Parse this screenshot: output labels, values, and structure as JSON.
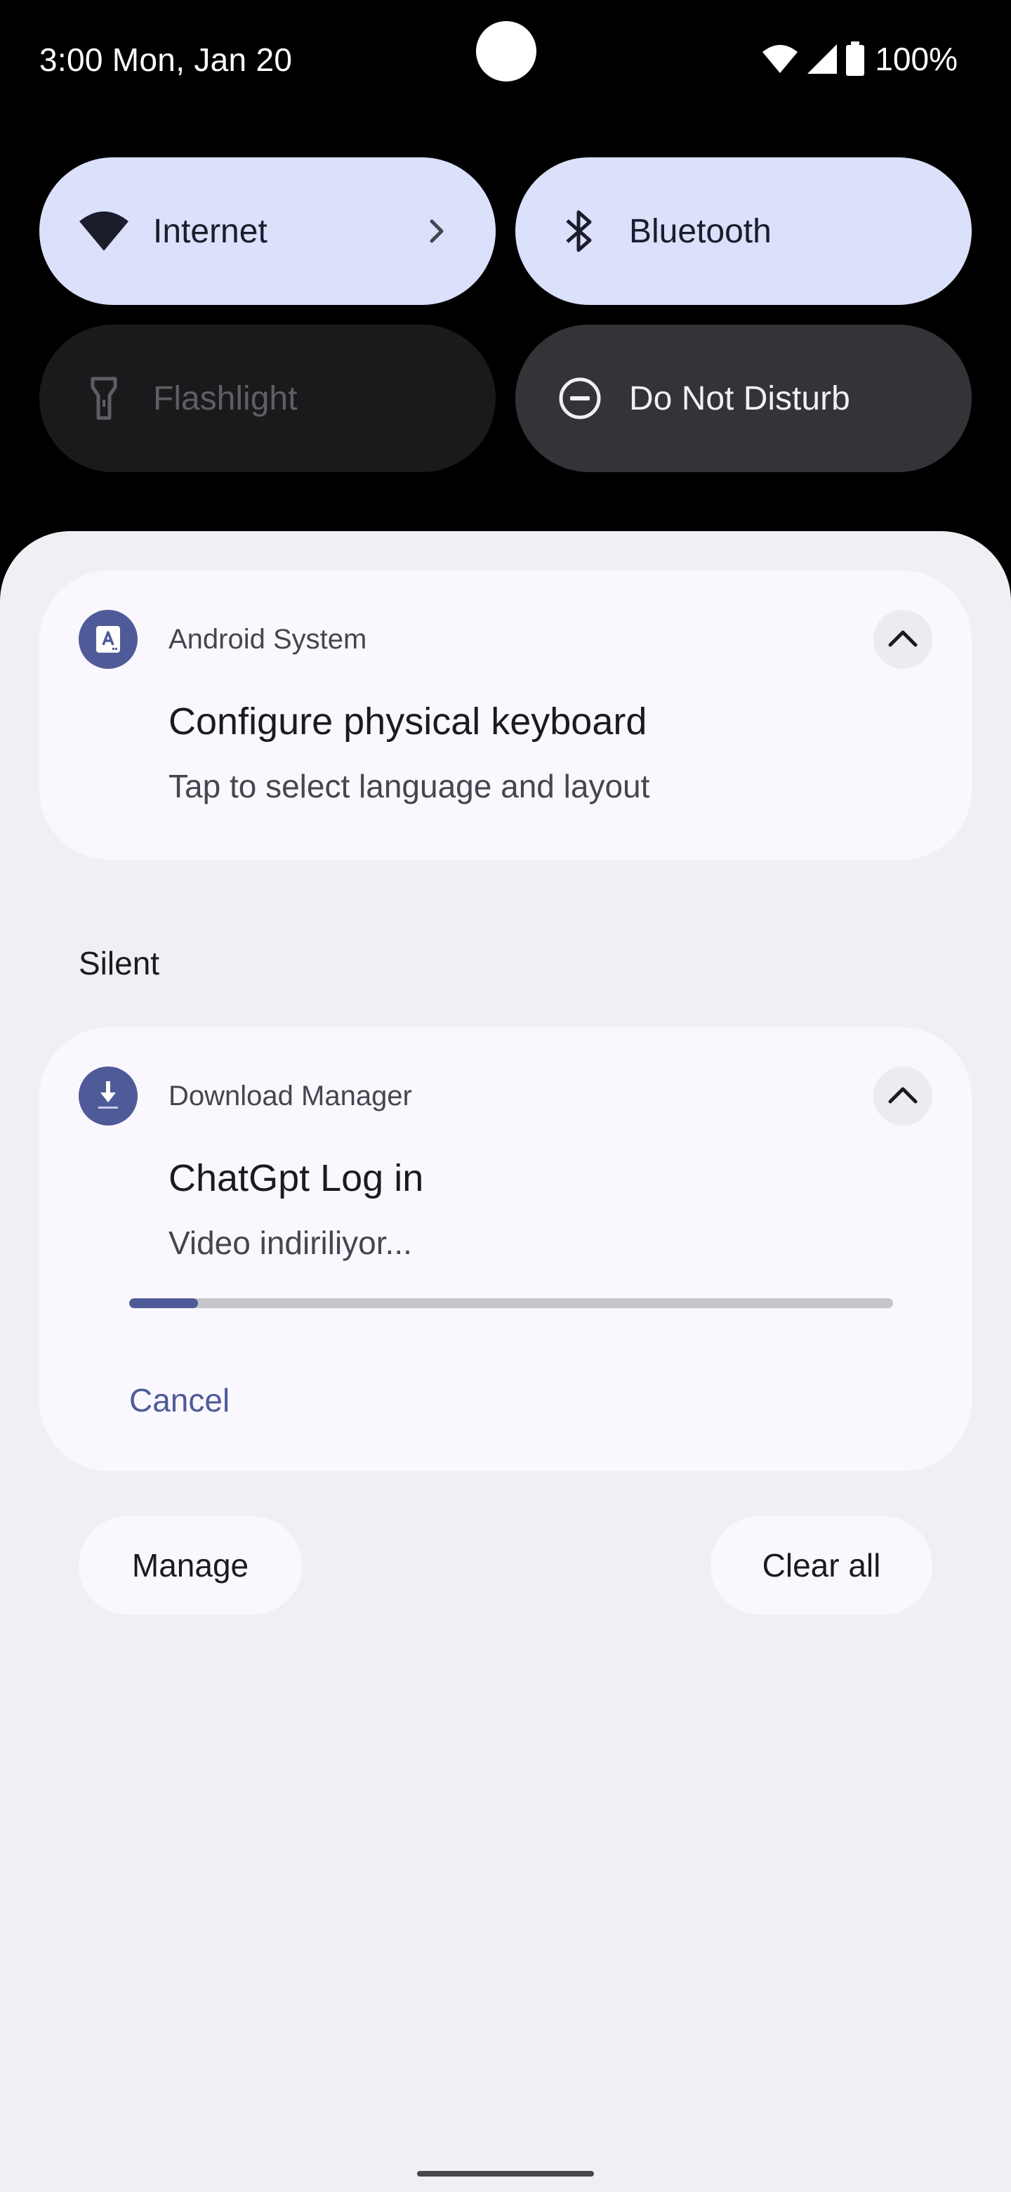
{
  "status_bar": {
    "time": "3:00 Mon, Jan 20",
    "battery": "100%",
    "icons": [
      "wifi-icon",
      "cell-signal-icon",
      "battery-icon"
    ]
  },
  "quick_settings": {
    "internet": {
      "label": "Internet",
      "state": "on",
      "icon": "wifi-icon"
    },
    "bluetooth": {
      "label": "Bluetooth",
      "state": "on",
      "icon": "bluetooth-icon"
    },
    "flashlight": {
      "label": "Flashlight",
      "state": "unavailable",
      "icon": "flashlight-icon"
    },
    "dnd": {
      "label": "Do Not Disturb",
      "state": "off",
      "icon": "do-not-disturb-icon"
    }
  },
  "notifications": {
    "keyboard": {
      "app": "Android System",
      "title": "Configure physical keyboard",
      "text": "Tap to select language and layout",
      "icon": "keyboard-icon"
    },
    "silent_label": "Silent",
    "download": {
      "app": "Download Manager",
      "title": "ChatGpt Log in",
      "text": "Video indiriliyor...",
      "progress": 0.09,
      "action": "Cancel",
      "icon": "download-icon"
    }
  },
  "footer": {
    "manage": "Manage",
    "clear_all": "Clear all"
  },
  "colors": {
    "accent": "#4f5b99",
    "tile_on": "#dbe0fb",
    "shade_bg": "#f1eff4",
    "card_bg": "#faf8fe"
  }
}
